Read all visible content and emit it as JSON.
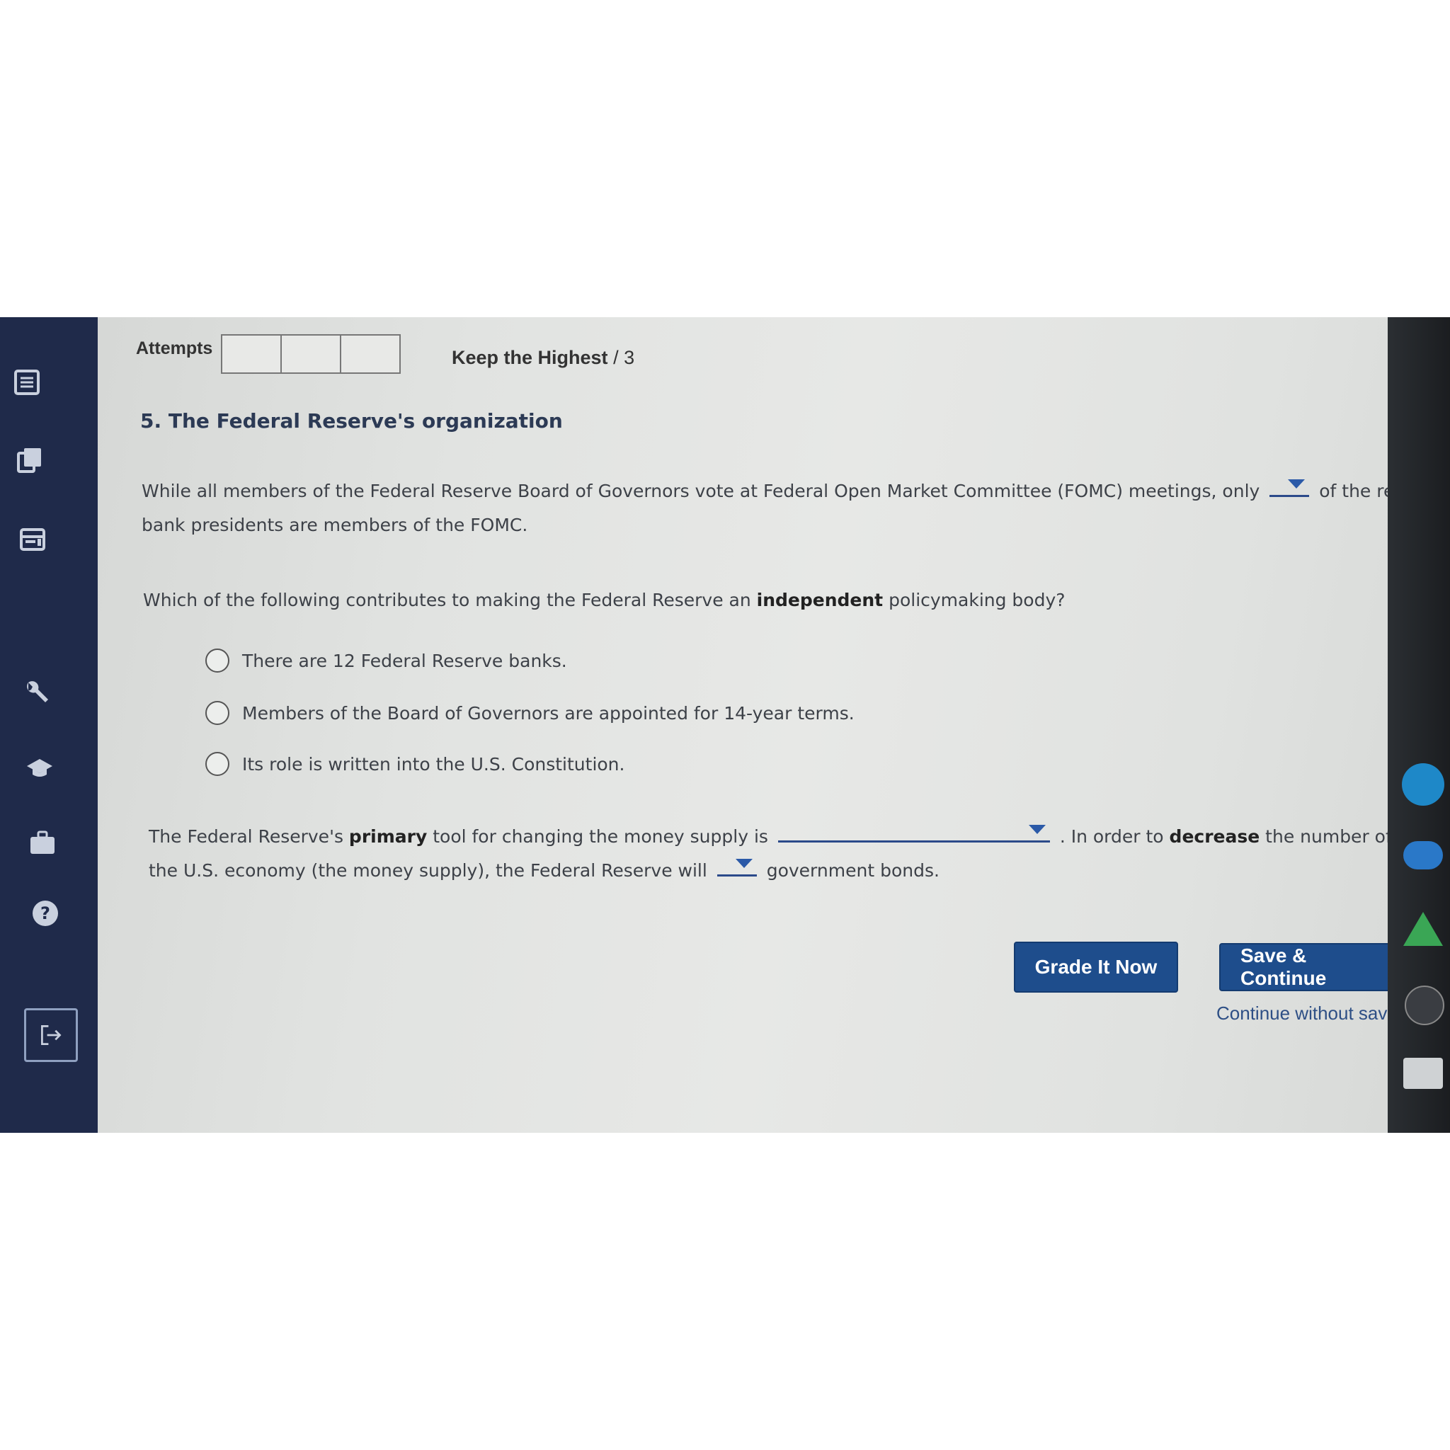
{
  "header": {
    "attempts_label": "Attempts",
    "keep_highest_label": "Keep the Highest",
    "keep_highest_total": "/ 3"
  },
  "question": {
    "title": "5. The Federal Reserve's organization",
    "p1_before": "While all members of the Federal Reserve Board of Governors vote at Federal Open Market Committee (FOMC) meetings, only",
    "p1_after": "of the regional",
    "p1_line2": "bank presidents are members of the FOMC.",
    "p2_before": "Which of the following contributes to making the Federal Reserve an",
    "p2_bold": "independent",
    "p2_after": "policymaking body?",
    "options": [
      "There are 12 Federal Reserve banks.",
      "Members of the Board of Governors are appointed for 14-year terms.",
      "Its role is written into the U.S. Constitution."
    ],
    "p3_before": "The Federal Reserve's",
    "p3_bold1": "primary",
    "p3_mid": "tool for changing the money supply is",
    "p3_after": ". In order to",
    "p3_bold2": "decrease",
    "p3_end": "the number of dolla",
    "p3_line2_before": "the U.S. economy (the money supply), the Federal Reserve will",
    "p3_line2_after": "government bonds."
  },
  "actions": {
    "grade_label": "Grade It Now",
    "save_label": "Save & Continue",
    "continue_label": "Continue without sav"
  },
  "sidebar": {
    "icons": [
      "list-icon",
      "books-icon",
      "calendar-icon",
      "wrench-icon",
      "graduation-cap-icon",
      "briefcase-icon",
      "help-icon",
      "logout-icon"
    ]
  }
}
